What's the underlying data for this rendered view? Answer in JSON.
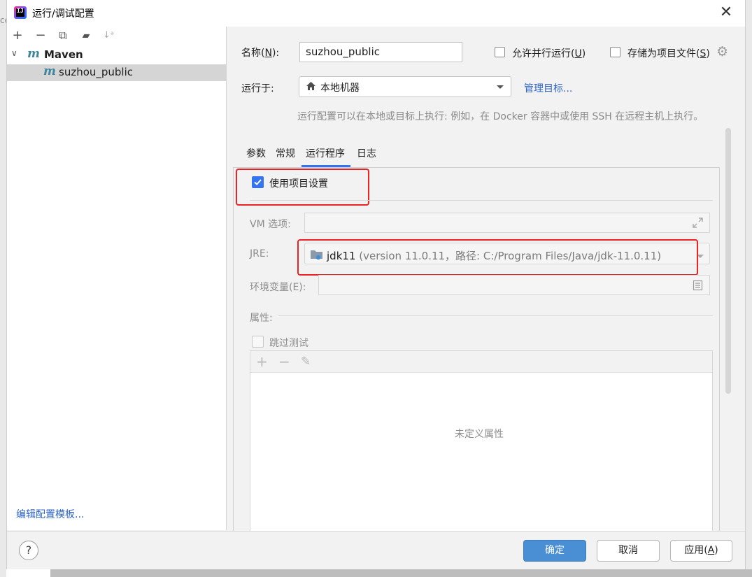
{
  "window": {
    "title": "运行/调试配置",
    "close_glyph": "✕",
    "left_stub": "ce"
  },
  "toolbar": {
    "add_glyph": "+",
    "remove_glyph": "−",
    "copy_glyph": "⧉",
    "folder_glyph": "▰",
    "sort_glyph": "↓ᵃ"
  },
  "tree": {
    "group": {
      "icon": "m",
      "label": "Maven"
    },
    "item": {
      "icon": "m",
      "label": "suzhou_public"
    }
  },
  "edit_templates_link": "编辑配置模板...",
  "form": {
    "name_label_prefix": "名称(",
    "name_label_mnemonic": "N",
    "name_label_suffix": "):",
    "name_value": "suzhou_public",
    "parallel_label_prefix": "允许并行运行(",
    "parallel_label_mnemonic": "U",
    "parallel_label_suffix": ")",
    "store_label_prefix": "存储为项目文件(",
    "store_label_mnemonic": "S",
    "store_label_suffix": ")",
    "run_on_label": "运行于:",
    "run_on_value": "本地机器",
    "manage_targets_link": "管理目标...",
    "hint": "运行配置可以在本地或目标上执行: 例如，在 Docker 容器中或使用 SSH 在远程主机上执行。"
  },
  "tabs": [
    {
      "label": "参数",
      "selected": false
    },
    {
      "label": "常规",
      "selected": false
    },
    {
      "label": "运行程序",
      "selected": true
    },
    {
      "label": "日志",
      "selected": false
    }
  ],
  "runner": {
    "use_project_settings_label": "使用项目设置",
    "use_project_settings_checked": true,
    "vm_options_label": "VM 选项:",
    "vm_options_value": "",
    "jre_label": "JRE:",
    "jre_name": "jdk11",
    "jre_detail": " (version 11.0.11，路径: C:/Program Files/Java/jdk-11.0.11)",
    "env_label": "环境变量(E):",
    "env_value": "",
    "properties_label": "属性:",
    "skip_tests_label": "跳过测试",
    "skip_tests_checked": false,
    "props_add_glyph": "+",
    "props_remove_glyph": "−",
    "props_edit_glyph": "✎",
    "empty_text": "未定义属性"
  },
  "buttons": {
    "help": "?",
    "ok": "确定",
    "cancel": "取消",
    "apply_prefix": "应用(",
    "apply_mnemonic": "A",
    "apply_suffix": ")"
  },
  "colors": {
    "accent": "#3574f0",
    "primary_button": "#4a8ed3",
    "highlight_box": "#ee2222",
    "link": "#2f65ca"
  }
}
